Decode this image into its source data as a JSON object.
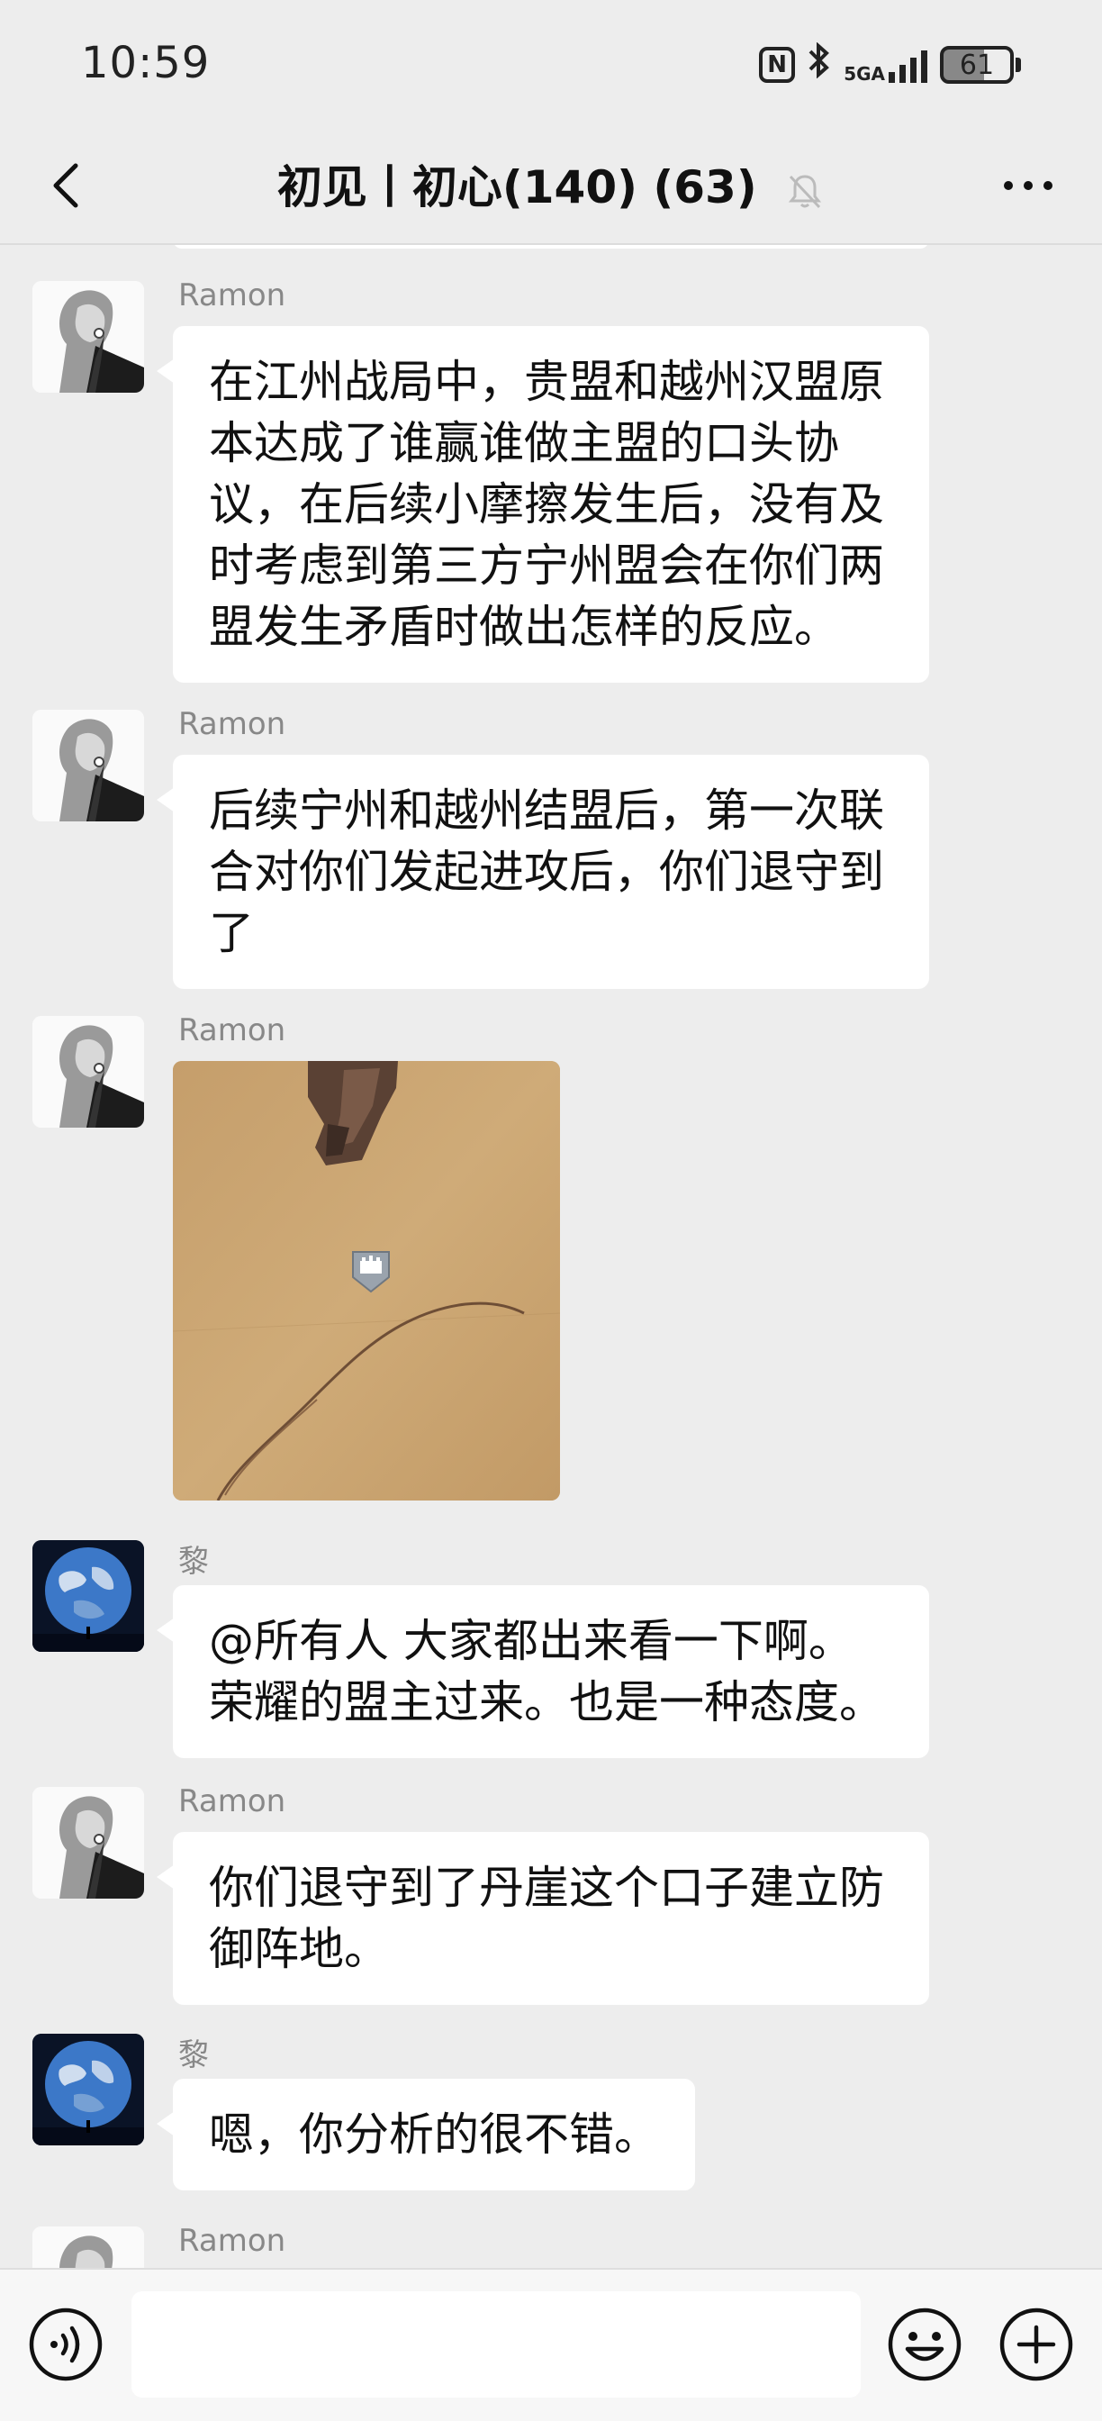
{
  "status_bar": {
    "time": "10:59",
    "network": "5GA",
    "battery": "61"
  },
  "header": {
    "title": "初见丨初心(140) (63)"
  },
  "messages": [
    {
      "sender": "Ramon",
      "avatar": "ramon-avatar",
      "text": "在江州战局中，贵盟和越州汉盟原本达成了谁赢谁做主盟的口头协议，在后续小摩擦发生后，没有及时考虑到第三方宁州盟会在你们两盟发生矛盾时做出怎样的反应。"
    },
    {
      "sender": "Ramon",
      "avatar": "ramon-avatar",
      "text": "后续宁州和越州结盟后，第一次联合对你们发起进攻后，你们退守到了"
    },
    {
      "sender": "Ramon",
      "avatar": "ramon-avatar",
      "type": "image",
      "image": "desert-map-screenshot"
    },
    {
      "sender": "黎",
      "avatar": "earth-avatar",
      "text": "@所有人  大家都出来看一下啊。荣耀的盟主过来。也是一种态度。"
    },
    {
      "sender": "Ramon",
      "avatar": "ramon-avatar",
      "text": "你们退守到了丹崖这个口子建立防御阵地。"
    },
    {
      "sender": "黎",
      "avatar": "earth-avatar",
      "text": "嗯，你分析的很不错。"
    },
    {
      "sender": "Ramon",
      "avatar": "ramon-avatar"
    }
  ],
  "input_bar": {
    "value": ""
  },
  "colors": {
    "background": "#ededed",
    "bubble": "#ffffff",
    "sender_text": "#888888"
  }
}
